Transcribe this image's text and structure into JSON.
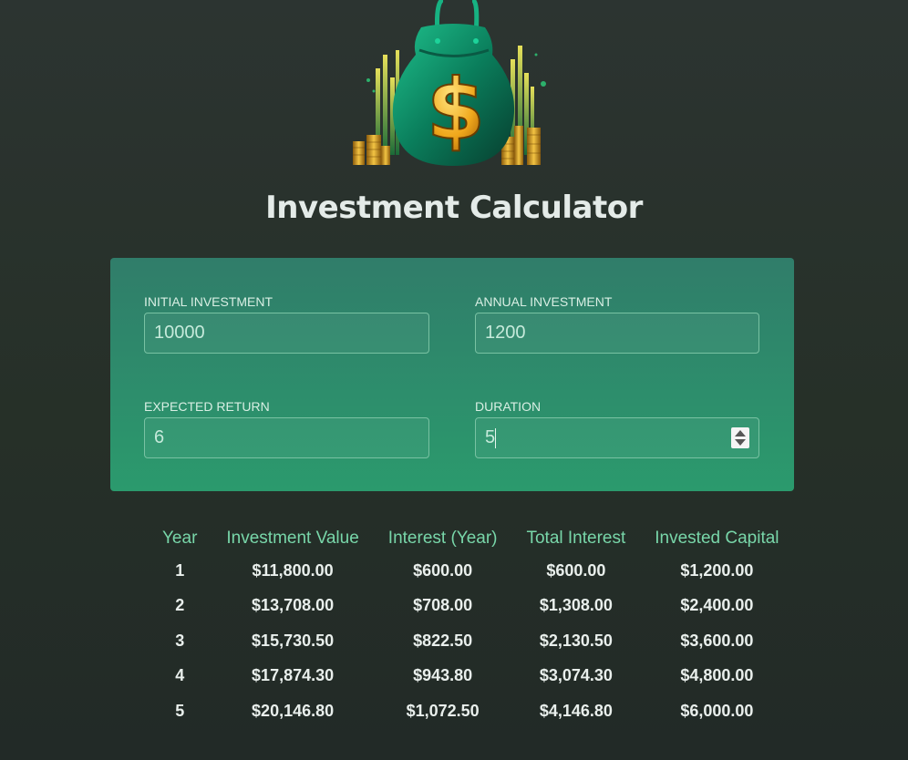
{
  "header": {
    "logo": "money-bag-dollar-logo",
    "title": "Investment Calculator"
  },
  "form": {
    "initial_investment": {
      "label": "INITIAL INVESTMENT",
      "value": "10000"
    },
    "annual_investment": {
      "label": "ANNUAL INVESTMENT",
      "value": "1200"
    },
    "expected_return": {
      "label": "EXPECTED RETURN",
      "value": "6"
    },
    "duration": {
      "label": "DURATION",
      "value": "5"
    }
  },
  "results": {
    "headers": [
      "Year",
      "Investment Value",
      "Interest (Year)",
      "Total Interest",
      "Invested Capital"
    ],
    "rows": [
      [
        "1",
        "$11,800.00",
        "$600.00",
        "$600.00",
        "$1,200.00"
      ],
      [
        "2",
        "$13,708.00",
        "$708.00",
        "$1,308.00",
        "$2,400.00"
      ],
      [
        "3",
        "$15,730.50",
        "$822.50",
        "$2,130.50",
        "$3,600.00"
      ],
      [
        "4",
        "$17,874.30",
        "$943.80",
        "$3,074.30",
        "$4,800.00"
      ],
      [
        "5",
        "$20,146.80",
        "$1,072.50",
        "$4,146.80",
        "$6,000.00"
      ]
    ]
  },
  "colors": {
    "background": "#2a322f",
    "panel_top": "#307d6a",
    "panel_bottom": "#2b9a6d",
    "header_text": "#78d6a9",
    "bag": "#0f8f67",
    "coin": "#d9a227"
  }
}
